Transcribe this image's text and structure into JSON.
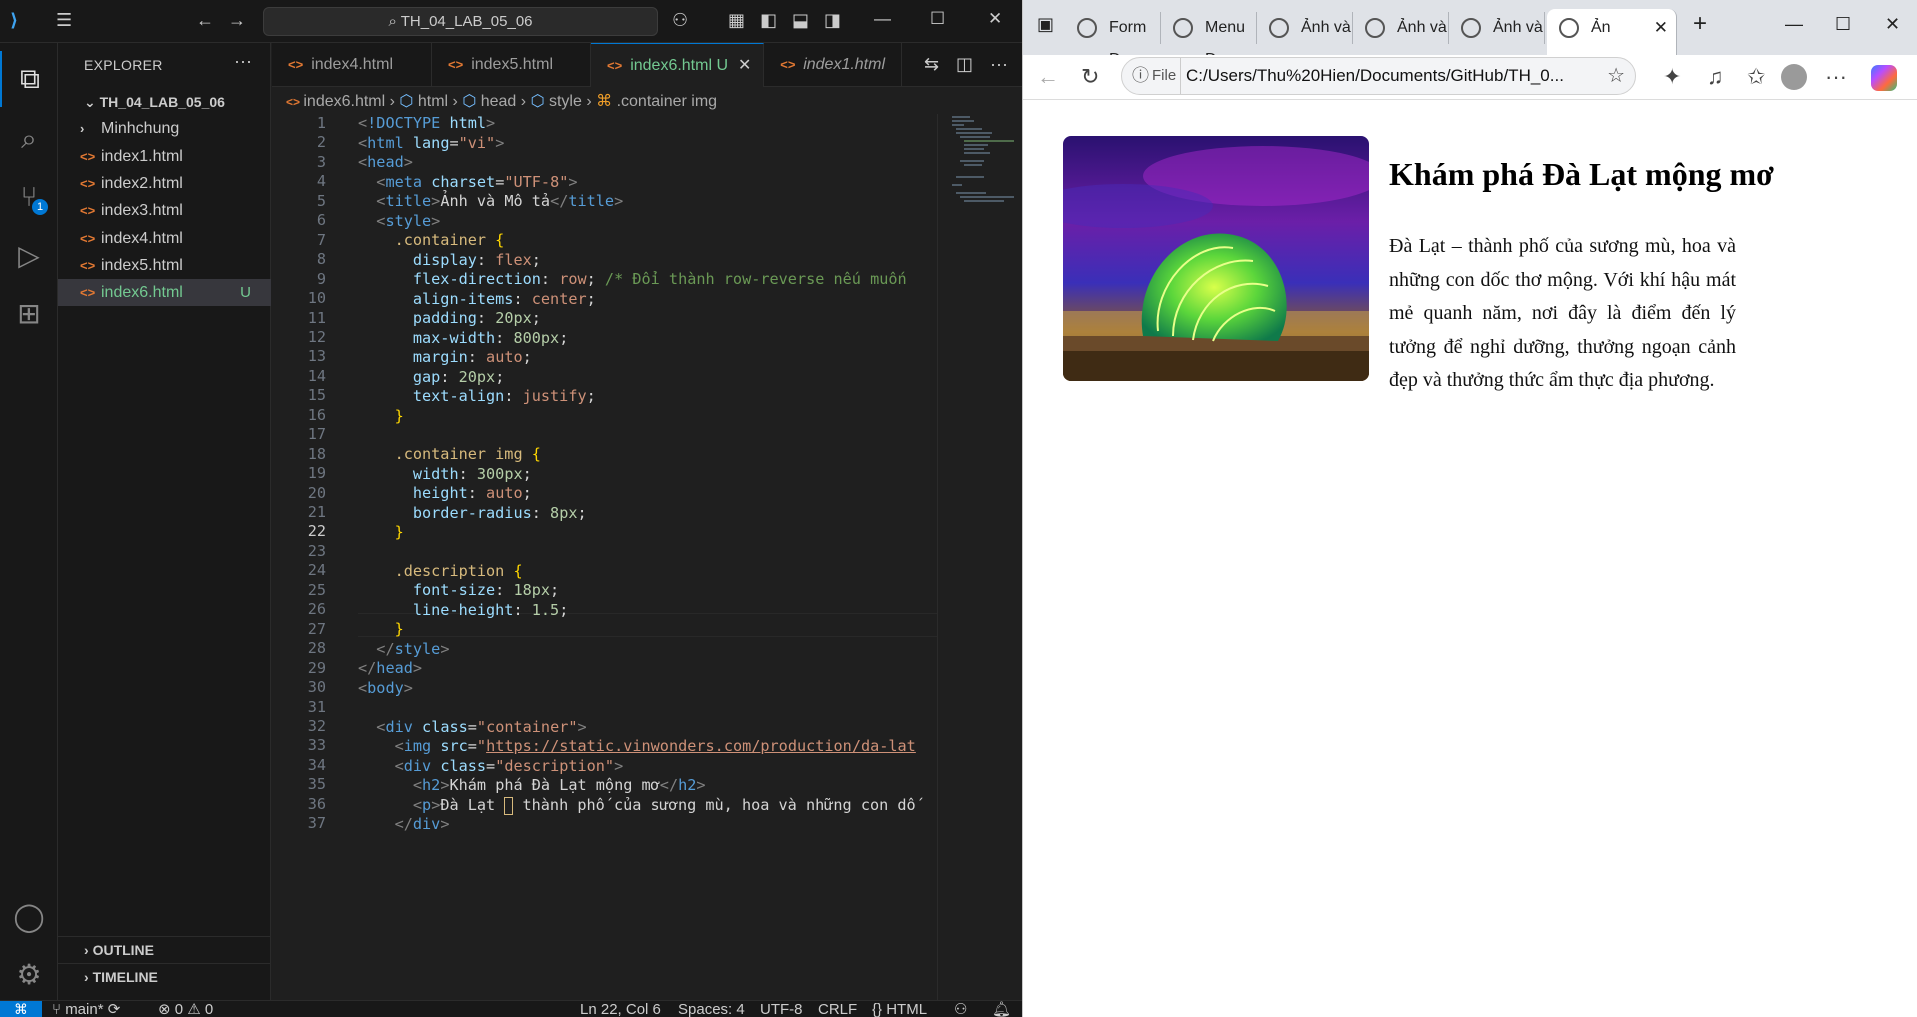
{
  "vscode": {
    "command_center": "TH_04_LAB_05_06",
    "explorer_title": "EXPLORER",
    "project": "TH_04_LAB_05_06",
    "tree": [
      {
        "name": "Minhchung",
        "type": "folder"
      },
      {
        "name": "index1.html",
        "type": "file"
      },
      {
        "name": "index2.html",
        "type": "file"
      },
      {
        "name": "index3.html",
        "type": "file"
      },
      {
        "name": "index4.html",
        "type": "file"
      },
      {
        "name": "index5.html",
        "type": "file"
      },
      {
        "name": "index6.html",
        "type": "file",
        "status": "U",
        "selected": true
      }
    ],
    "outline": "OUTLINE",
    "timeline": "TIMELINE",
    "scm_badge": "1",
    "tabs": [
      {
        "label": "index4.html"
      },
      {
        "label": "index5.html"
      },
      {
        "label": "index6.html",
        "status": "U",
        "active": true
      },
      {
        "label": "index1.html",
        "italic": true
      }
    ],
    "breadcrumb": [
      "index6.html",
      "html",
      "head",
      "style",
      ".container img"
    ],
    "status": {
      "branch": "main*",
      "errors": "0",
      "warnings": "0",
      "position": "Ln 22, Col 6",
      "spaces": "Spaces: 4",
      "encoding": "UTF-8",
      "eol": "CRLF",
      "language": "HTML"
    },
    "current_line": 22,
    "line_numbers": [
      "1",
      "2",
      "3",
      "4",
      "5",
      "6",
      "7",
      "8",
      "9",
      "10",
      "11",
      "12",
      "13",
      "14",
      "15",
      "16",
      "17",
      "18",
      "19",
      "20",
      "21",
      "22",
      "23",
      "24",
      "25",
      "26",
      "27",
      "28",
      "29",
      "30",
      "31",
      "32",
      "33",
      "34",
      "35",
      "36",
      "37"
    ]
  },
  "browser": {
    "tabs": [
      {
        "label": "Form Đ"
      },
      {
        "label": "Menu Đ"
      },
      {
        "label": "Ảnh và"
      },
      {
        "label": "Ảnh và"
      },
      {
        "label": "Ảnh và"
      },
      {
        "label": "Ản",
        "active": true
      }
    ],
    "url_scheme": "File",
    "url": "C:/Users/Thu%20Hien/Documents/GitHub/TH_0...",
    "page": {
      "heading": "Khám phá Đà Lạt mộng mơ",
      "paragraph": "Đà Lạt – thành phố của sương mù, hoa và những con dốc thơ mộng. Với khí hậu mát mẻ quanh năm, nơi đây là điểm đến lý tưởng để nghỉ dưỡng, thưởng ngoạn cảnh đẹp và thưởng thức ẩm thực địa phương."
    }
  },
  "colors": {
    "accent": "#0078d4",
    "untracked": "#73c991",
    "html_icon": "#e37933"
  }
}
